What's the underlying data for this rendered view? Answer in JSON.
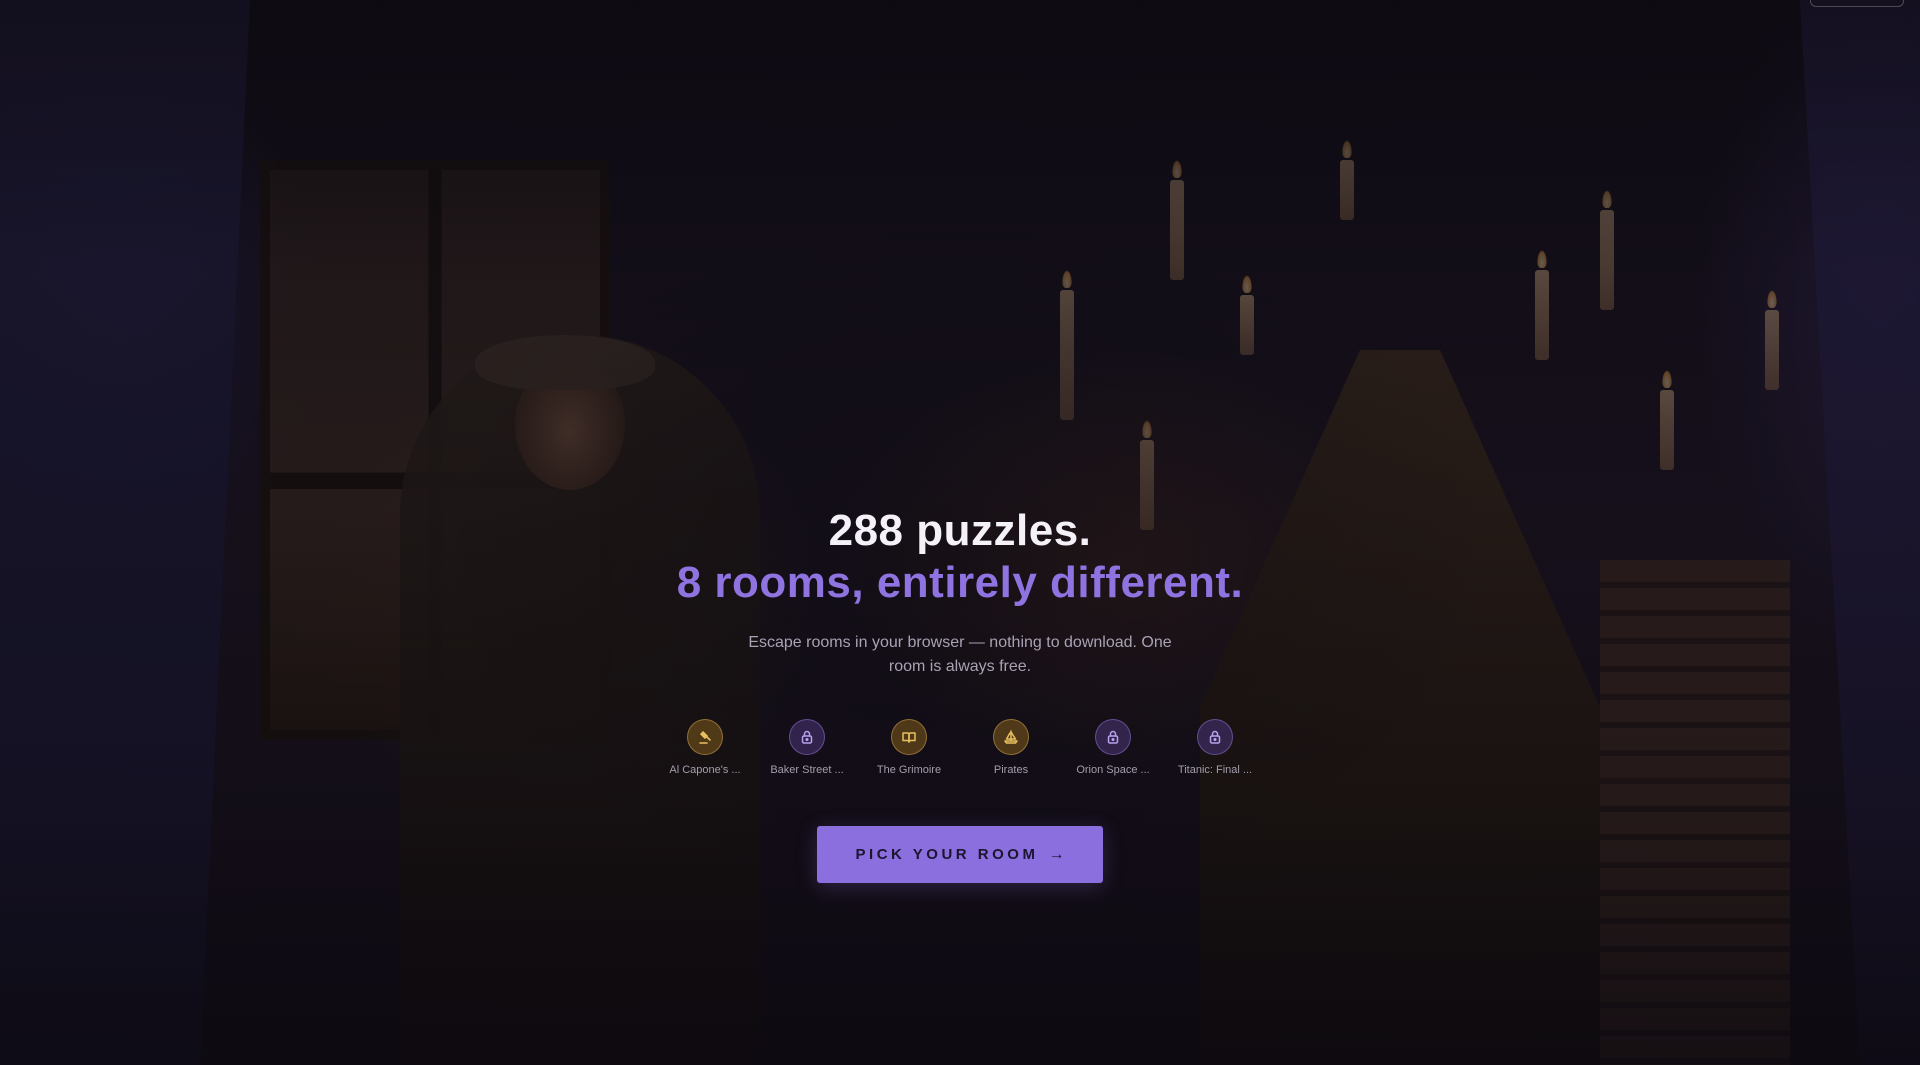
{
  "hero": {
    "headline_line1": "288 puzzles.",
    "headline_line2": "8 rooms, entirely different.",
    "subtext": "Escape rooms in your browser — nothing to download. One room is always free."
  },
  "rooms": [
    {
      "label": "Al Capone's ...",
      "icon": "gavel-icon",
      "locked": false
    },
    {
      "label": "Baker Street ...",
      "icon": "lock-icon",
      "locked": true
    },
    {
      "label": "The Grimoire",
      "icon": "book-icon",
      "locked": false
    },
    {
      "label": "Pirates",
      "icon": "sailboat-icon",
      "locked": false
    },
    {
      "label": "Orion Space ...",
      "icon": "lock-icon",
      "locked": true
    },
    {
      "label": "Titanic: Final ...",
      "icon": "lock-icon",
      "locked": true
    }
  ],
  "cta": {
    "label": "PICK YOUR ROOM",
    "arrow": "→"
  },
  "colors": {
    "accent": "#8b6fde",
    "headline_accent": "#8f73e0",
    "unlocked_icon": "#e8c060",
    "locked_icon": "#b7a2f0",
    "background": "#120e18"
  }
}
